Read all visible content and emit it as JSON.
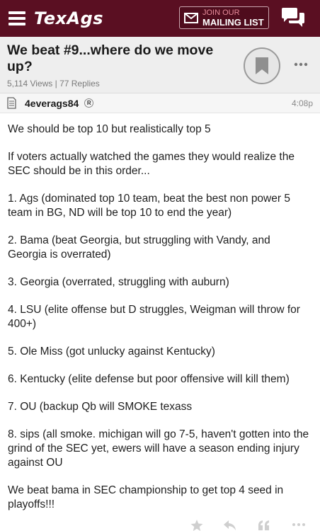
{
  "header": {
    "logo": "TexAgs",
    "mailing_line1": "JOIN OUR",
    "mailing_line2": "MAILING LIST",
    "icons": [
      "hamburger-menu-icon",
      "mail-envelope-icon",
      "chat-bubbles-icon"
    ],
    "colors": {
      "brand": "#5a0f22",
      "accent": "#e78b9a"
    }
  },
  "thread": {
    "title": "We beat #9...where do we move up?",
    "views": "5,114 Views",
    "separator": "|",
    "replies": "77 Replies",
    "icons": [
      "bookmark-icon",
      "more-options-icon"
    ]
  },
  "post": {
    "author": "4everags84",
    "badge": "R",
    "time": "4:08p",
    "paragraphs": [
      "We should be top 10 but realistically top 5",
      "If voters actually watched the games they would realize the SEC should be in this order...",
      "1. Ags (dominated top 10 team, beat the best non power 5 team in BG, ND will be top 10 to end the year)",
      "2. Bama (beat Georgia, but struggling with Vandy, and Georgia is overrated)",
      "3. Georgia (overrated, struggling with auburn)",
      "4. LSU (elite offense but D struggles, Weigman will throw for 400+)",
      "5. Ole Miss (got unlucky against Kentucky)",
      "6. Kentucky (elite defense but poor offensive will kill them)",
      "7. OU (backup Qb will SMOKE texass",
      "8. sips (all smoke. michigan will go 7-5, haven't gotten into the grind of the SEC yet, ewers will have a season ending injury against OU",
      "We beat bama in SEC championship to get top 4 seed in playoffs!!!"
    ],
    "action_icons": [
      "star-icon",
      "reply-icon",
      "quote-icon",
      "more-options-icon"
    ]
  }
}
